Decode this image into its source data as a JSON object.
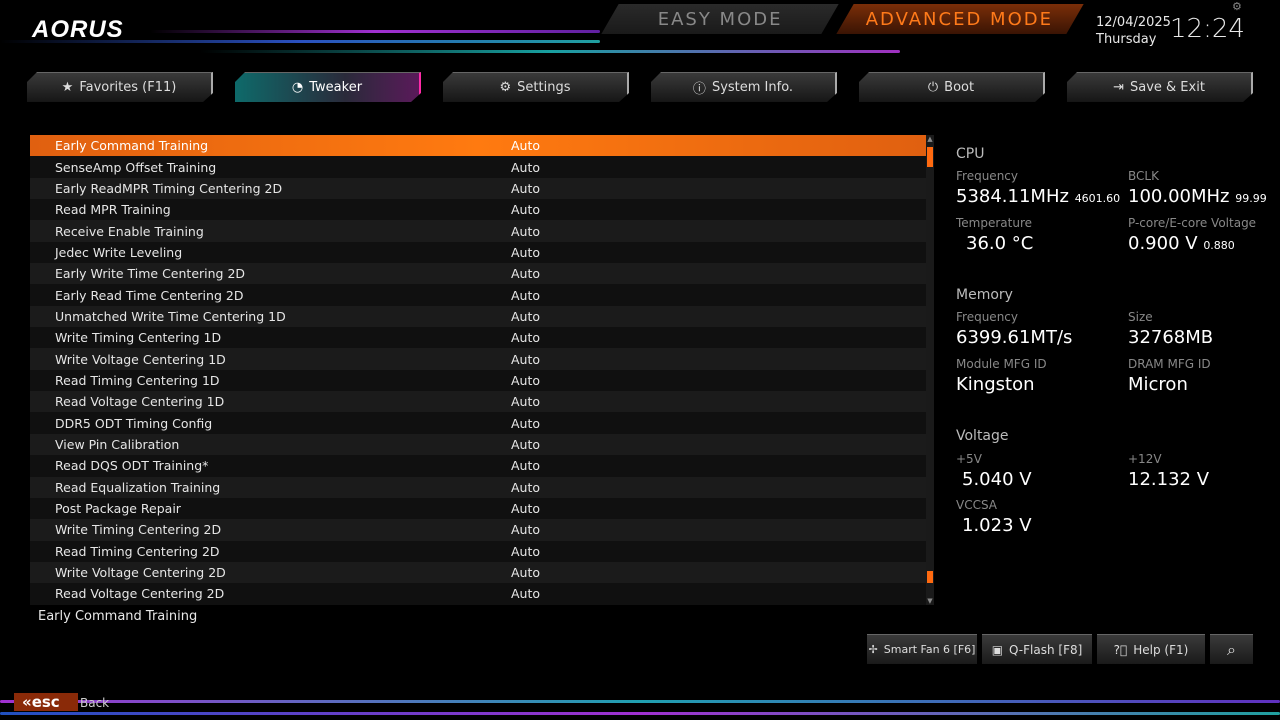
{
  "header": {
    "logo": "AORUS",
    "easy_mode": "EASY MODE",
    "advanced_mode": "ADVANCED MODE",
    "date": "12/04/2025",
    "day": "Thursday",
    "time": "12:24"
  },
  "tabs": [
    {
      "label": "Favorites (F11)",
      "icon": "star-folder-icon"
    },
    {
      "label": "Tweaker",
      "icon": "speedometer-icon"
    },
    {
      "label": "Settings",
      "icon": "gear-icon"
    },
    {
      "label": "System Info.",
      "icon": "info-icon"
    },
    {
      "label": "Boot",
      "icon": "power-icon"
    },
    {
      "label": "Save & Exit",
      "icon": "exit-icon"
    }
  ],
  "settings": [
    {
      "label": "Early Command Training",
      "value": "Auto"
    },
    {
      "label": "SenseAmp Offset Training",
      "value": "Auto"
    },
    {
      "label": "Early ReadMPR Timing Centering 2D",
      "value": "Auto"
    },
    {
      "label": "Read MPR Training",
      "value": "Auto"
    },
    {
      "label": "Receive Enable Training",
      "value": "Auto"
    },
    {
      "label": "Jedec Write Leveling",
      "value": "Auto"
    },
    {
      "label": "Early Write Time Centering 2D",
      "value": "Auto"
    },
    {
      "label": "Early Read Time Centering 2D",
      "value": "Auto"
    },
    {
      "label": "Unmatched Write Time Centering 1D",
      "value": "Auto"
    },
    {
      "label": "Write Timing Centering 1D",
      "value": "Auto"
    },
    {
      "label": "Write Voltage Centering 1D",
      "value": "Auto"
    },
    {
      "label": "Read Timing Centering 1D",
      "value": "Auto"
    },
    {
      "label": "Read Voltage Centering 1D",
      "value": "Auto"
    },
    {
      "label": "DDR5 ODT Timing Config",
      "value": "Auto"
    },
    {
      "label": "View Pin Calibration",
      "value": "Auto"
    },
    {
      "label": "Read DQS ODT Training*",
      "value": "Auto"
    },
    {
      "label": "Read Equalization Training",
      "value": "Auto"
    },
    {
      "label": "Post Package Repair",
      "value": "Auto"
    },
    {
      "label": "Write Timing Centering 2D",
      "value": "Auto"
    },
    {
      "label": "Read Timing Centering 2D",
      "value": "Auto"
    },
    {
      "label": "Write Voltage Centering 2D",
      "value": "Auto"
    },
    {
      "label": "Read Voltage Centering 2D",
      "value": "Auto"
    }
  ],
  "help_text": "Early Command Training",
  "cpu": {
    "title": "CPU",
    "freq_label": "Frequency",
    "freq": "5384.11MHz",
    "freq_sub": "4601.60",
    "bclk_label": "BCLK",
    "bclk": "100.00MHz",
    "bclk_sub": "99.99",
    "temp_label": "Temperature",
    "temp": "36.0 °C",
    "volt_label": "P-core/E-core Voltage",
    "volt": "0.900 V",
    "volt_sub": "0.880"
  },
  "memory": {
    "title": "Memory",
    "freq_label": "Frequency",
    "freq": "6399.61MT/s",
    "size_label": "Size",
    "size": "32768MB",
    "module_label": "Module MFG ID",
    "module": "Kingston",
    "dram_label": "DRAM MFG ID",
    "dram": "Micron"
  },
  "voltage": {
    "title": "Voltage",
    "v5_label": "+5V",
    "v5": "5.040 V",
    "v12_label": "+12V",
    "v12": "12.132 V",
    "vccsa_label": "VCCSA",
    "vccsa": "1.023 V"
  },
  "footer": {
    "smartfan": "Smart Fan 6 [F6]",
    "qflash": "Q-Flash [F8]",
    "help": "Help (F1)",
    "esc": "esc",
    "back": "Back"
  },
  "scroll": {
    "position_fraction": 0.0,
    "visible_fraction": 0.04
  }
}
